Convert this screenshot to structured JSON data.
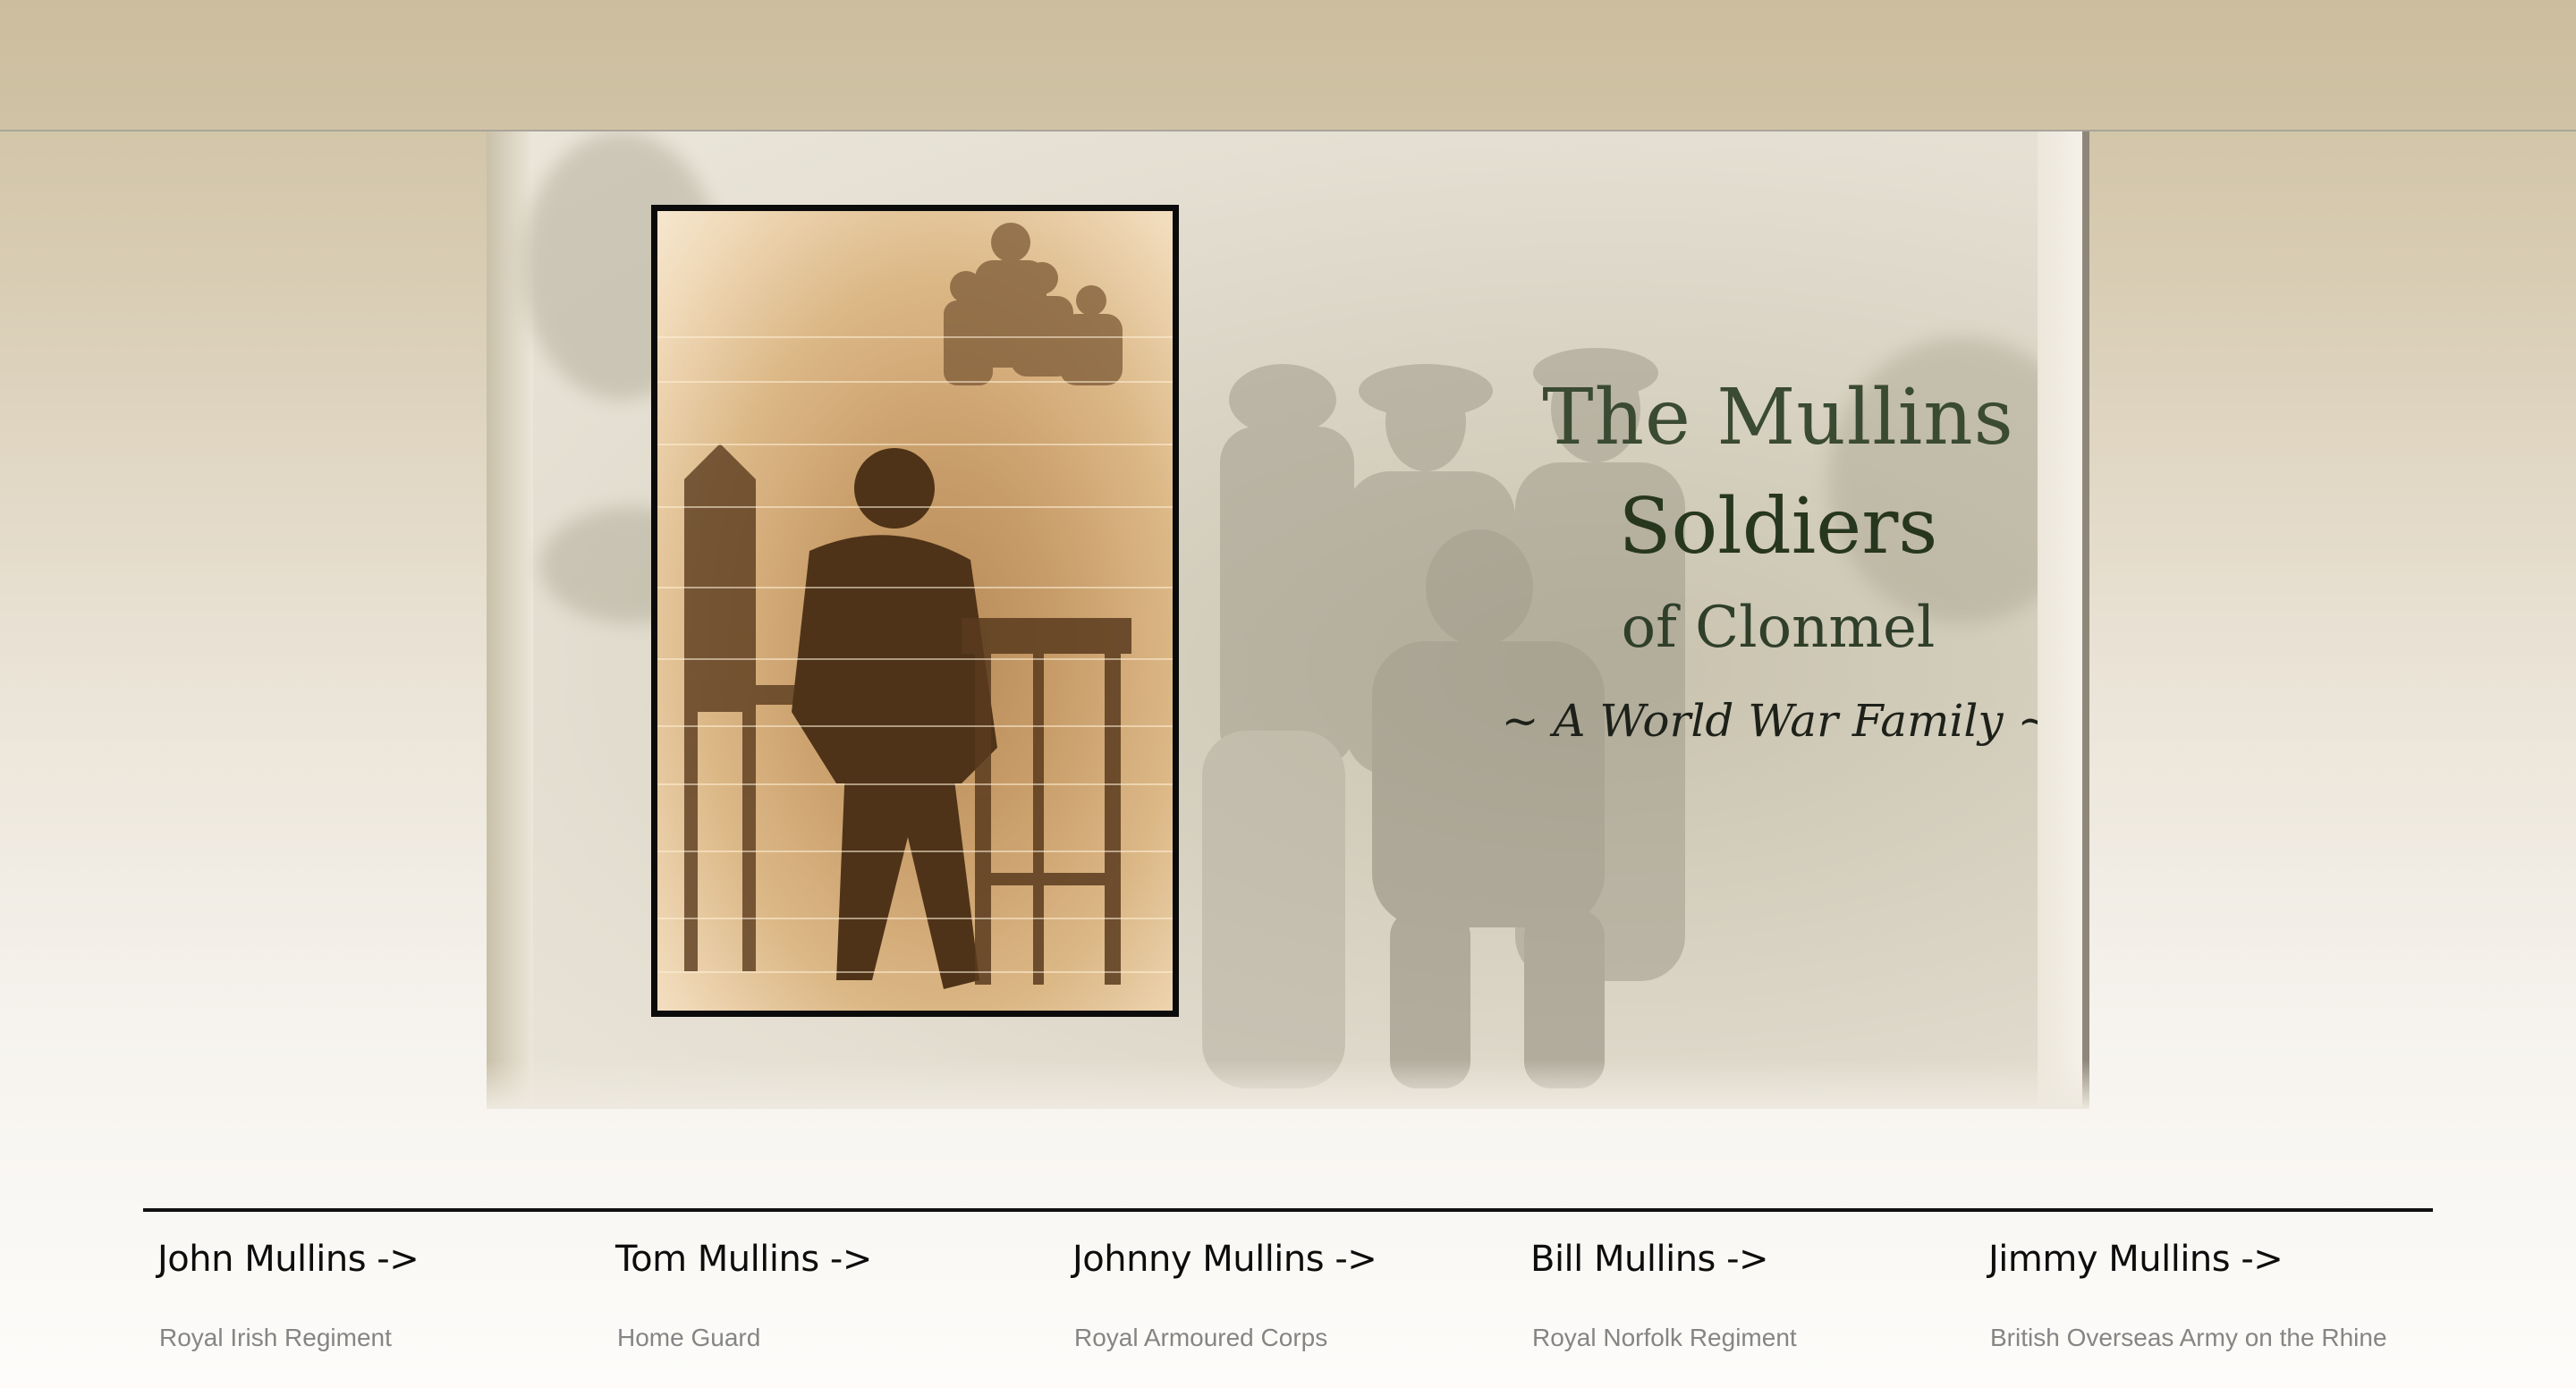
{
  "hero": {
    "title_line1": "The Mullins",
    "title_line2": "Soldiers",
    "title_line3": "of Clonmel",
    "tagline": "~ A World War Family ~"
  },
  "soldiers": [
    {
      "name": "John Mullins ->",
      "unit": "Royal Irish Regiment"
    },
    {
      "name": "Tom Mullins ->",
      "unit": "Home Guard"
    },
    {
      "name": "Johnny Mullins ->",
      "unit": "Royal Armoured Corps"
    },
    {
      "name": "Bill Mullins ->",
      "unit": "Royal Norfolk Regiment"
    },
    {
      "name": "Jimmy Mullins ->",
      "unit": "British Overseas Army on the Rhine"
    }
  ],
  "colors": {
    "header_band": "#cbbd9d",
    "title_green": "#2f3f2a",
    "divider": "#111111",
    "unit_gray": "#858585"
  }
}
